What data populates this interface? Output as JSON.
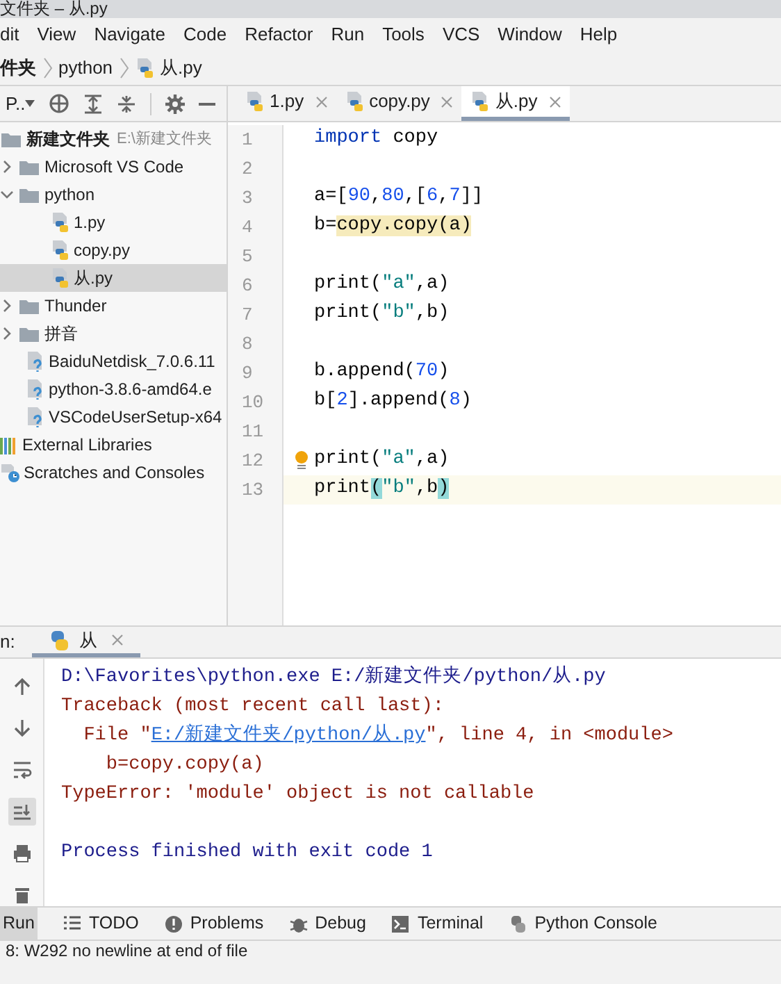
{
  "window": {
    "title": "文件夹 – 从.py"
  },
  "menu": [
    "dit",
    "View",
    "Navigate",
    "Code",
    "Refactor",
    "Run",
    "Tools",
    "VCS",
    "Window",
    "Help"
  ],
  "breadcrumb": [
    "件夹",
    "python",
    "从.py"
  ],
  "project_toolbar": {
    "label": "P.."
  },
  "editor_tabs": [
    {
      "label": "1.py",
      "selected": false
    },
    {
      "label": "copy.py",
      "selected": false
    },
    {
      "label": "从.py",
      "selected": true
    }
  ],
  "tree": [
    {
      "label": "新建文件夹",
      "hint": "E:\\新建文件夹",
      "kind": "root",
      "selected": false,
      "children": [
        {
          "label": "Microsoft VS Code",
          "kind": "folder",
          "expanded": false,
          "selected": false
        },
        {
          "label": "python",
          "kind": "folder",
          "expanded": true,
          "selected": false,
          "children": [
            {
              "label": "1.py",
              "kind": "py",
              "selected": false
            },
            {
              "label": "copy.py",
              "kind": "py",
              "selected": false
            },
            {
              "label": "从.py",
              "kind": "py",
              "selected": true
            }
          ]
        },
        {
          "label": "Thunder",
          "kind": "folder",
          "expanded": false,
          "selected": false
        },
        {
          "label": "拼音",
          "kind": "folder",
          "expanded": false,
          "selected": false
        },
        {
          "label": "BaiduNetdisk_7.0.6.11",
          "kind": "unknown",
          "selected": false
        },
        {
          "label": "python-3.8.6-amd64.e",
          "kind": "unknown",
          "selected": false
        },
        {
          "label": "VSCodeUserSetup-x64",
          "kind": "unknown",
          "selected": false
        }
      ]
    },
    {
      "label": "External Libraries",
      "kind": "libraries",
      "selected": false
    },
    {
      "label": "Scratches and Consoles",
      "kind": "scratches",
      "selected": false
    }
  ],
  "code_lines": [
    {
      "number": "1",
      "current": false,
      "bulb": false,
      "segments": [
        {
          "text": "import",
          "kind": "keyword"
        },
        {
          "text": " copy",
          "kind": "plain"
        }
      ]
    },
    {
      "number": "2",
      "current": false,
      "bulb": false
    },
    {
      "number": "3",
      "current": false,
      "bulb": false,
      "segments": [
        {
          "text": "a=[",
          "kind": "plain"
        },
        {
          "text": "90",
          "kind": "number"
        },
        {
          "text": ",",
          "kind": "plain"
        },
        {
          "text": "80",
          "kind": "number"
        },
        {
          "text": ",[",
          "kind": "plain"
        },
        {
          "text": "6",
          "kind": "number"
        },
        {
          "text": ",",
          "kind": "plain"
        },
        {
          "text": "7",
          "kind": "number"
        },
        {
          "text": "]]",
          "kind": "plain"
        }
      ]
    },
    {
      "number": "4",
      "current": false,
      "bulb": false,
      "segments": [
        {
          "text": "b=",
          "kind": "plain"
        },
        {
          "text": "copy.copy(a)",
          "kind": "warning"
        }
      ]
    },
    {
      "number": "5",
      "current": false,
      "bulb": false
    },
    {
      "number": "6",
      "current": false,
      "bulb": false,
      "segments": [
        {
          "text": "print(",
          "kind": "plain"
        },
        {
          "text": "\"a\"",
          "kind": "string"
        },
        {
          "text": ",a)",
          "kind": "plain"
        }
      ]
    },
    {
      "number": "7",
      "current": false,
      "bulb": false,
      "segments": [
        {
          "text": "print(",
          "kind": "plain"
        },
        {
          "text": "\"b\"",
          "kind": "string"
        },
        {
          "text": ",b)",
          "kind": "plain"
        }
      ]
    },
    {
      "number": "8",
      "current": false,
      "bulb": false
    },
    {
      "number": "9",
      "current": false,
      "bulb": false,
      "segments": [
        {
          "text": "b.append(",
          "kind": "plain"
        },
        {
          "text": "70",
          "kind": "number"
        },
        {
          "text": ")",
          "kind": "plain"
        }
      ]
    },
    {
      "number": "10",
      "current": false,
      "bulb": false,
      "segments": [
        {
          "text": "b[",
          "kind": "plain"
        },
        {
          "text": "2",
          "kind": "number"
        },
        {
          "text": "].append(",
          "kind": "plain"
        },
        {
          "text": "8",
          "kind": "number"
        },
        {
          "text": ")",
          "kind": "plain"
        }
      ]
    },
    {
      "number": "11",
      "current": false,
      "bulb": false
    },
    {
      "number": "12",
      "current": false,
      "bulb": true,
      "segments": [
        {
          "text": "print(",
          "kind": "plain"
        },
        {
          "text": "\"a\"",
          "kind": "string"
        },
        {
          "text": ",a)",
          "kind": "plain"
        }
      ]
    },
    {
      "number": "13",
      "current": true,
      "bulb": false,
      "segments": [
        {
          "text": "print",
          "kind": "plain"
        },
        {
          "text": "(",
          "kind": "brace"
        },
        {
          "text": "\"b\"",
          "kind": "string"
        },
        {
          "text": ",b",
          "kind": "plain"
        },
        {
          "text": ")",
          "kind": "brace"
        }
      ]
    }
  ],
  "run_panel": {
    "label": "n:",
    "tab": "从"
  },
  "console": [
    {
      "kind": "command",
      "segments": [
        {
          "text": "D:\\Favorites\\python.exe E:/新建文件夹/python/从.py",
          "kind": "text"
        }
      ]
    },
    {
      "kind": "error",
      "segments": [
        {
          "text": "Traceback (most recent call last):",
          "kind": "text"
        }
      ]
    },
    {
      "kind": "error",
      "segments": [
        {
          "text": "  File \"",
          "kind": "text"
        },
        {
          "text": "E:/新建文件夹/python/从.py",
          "kind": "link"
        },
        {
          "text": "\", line 4, in <module>",
          "kind": "text"
        }
      ]
    },
    {
      "kind": "error",
      "segments": [
        {
          "text": "    b=copy.copy(a)",
          "kind": "text"
        }
      ]
    },
    {
      "kind": "error",
      "segments": [
        {
          "text": "TypeError: 'module' object is not callable",
          "kind": "text"
        }
      ]
    },
    {
      "kind": "blank"
    },
    {
      "kind": "command",
      "segments": [
        {
          "text": "Process finished with exit code 1",
          "kind": "text"
        }
      ]
    }
  ],
  "tool_windows": [
    {
      "label": "Run",
      "kind": "run",
      "selected": true
    },
    {
      "label": "TODO",
      "kind": "todo",
      "selected": false
    },
    {
      "label": "Problems",
      "kind": "problems",
      "selected": false
    },
    {
      "label": "Debug",
      "kind": "debug",
      "selected": false
    },
    {
      "label": "Terminal",
      "kind": "terminal",
      "selected": false
    },
    {
      "label": "Python Console",
      "kind": "console",
      "selected": false
    }
  ],
  "status_bar": {
    "message": "8: W292 no newline at end of file"
  }
}
